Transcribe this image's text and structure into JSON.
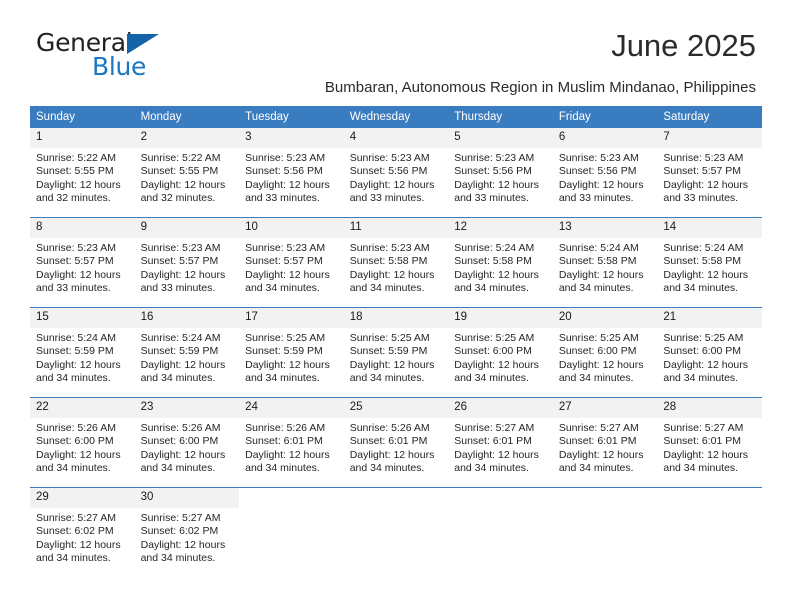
{
  "brand": {
    "name_top": "General",
    "name_bottom": "Blue",
    "color_dark": "#231f20",
    "color_blue": "#1b77c4"
  },
  "header": {
    "month_title": "June 2025",
    "location": "Bumbaran, Autonomous Region in Muslim Mindanao, Philippines"
  },
  "theme": {
    "header_bg": "#3a7cc0",
    "daynum_bg": "#f2f2f2",
    "grid_line": "#3a7cc0"
  },
  "calendar": {
    "weekday_headers": [
      "Sunday",
      "Monday",
      "Tuesday",
      "Wednesday",
      "Thursday",
      "Friday",
      "Saturday"
    ],
    "weeks": [
      [
        {
          "day": "1",
          "sunrise": "Sunrise: 5:22 AM",
          "sunset": "Sunset: 5:55 PM",
          "daylight_1": "Daylight: 12 hours",
          "daylight_2": "and 32 minutes."
        },
        {
          "day": "2",
          "sunrise": "Sunrise: 5:22 AM",
          "sunset": "Sunset: 5:55 PM",
          "daylight_1": "Daylight: 12 hours",
          "daylight_2": "and 32 minutes."
        },
        {
          "day": "3",
          "sunrise": "Sunrise: 5:23 AM",
          "sunset": "Sunset: 5:56 PM",
          "daylight_1": "Daylight: 12 hours",
          "daylight_2": "and 33 minutes."
        },
        {
          "day": "4",
          "sunrise": "Sunrise: 5:23 AM",
          "sunset": "Sunset: 5:56 PM",
          "daylight_1": "Daylight: 12 hours",
          "daylight_2": "and 33 minutes."
        },
        {
          "day": "5",
          "sunrise": "Sunrise: 5:23 AM",
          "sunset": "Sunset: 5:56 PM",
          "daylight_1": "Daylight: 12 hours",
          "daylight_2": "and 33 minutes."
        },
        {
          "day": "6",
          "sunrise": "Sunrise: 5:23 AM",
          "sunset": "Sunset: 5:56 PM",
          "daylight_1": "Daylight: 12 hours",
          "daylight_2": "and 33 minutes."
        },
        {
          "day": "7",
          "sunrise": "Sunrise: 5:23 AM",
          "sunset": "Sunset: 5:57 PM",
          "daylight_1": "Daylight: 12 hours",
          "daylight_2": "and 33 minutes."
        }
      ],
      [
        {
          "day": "8",
          "sunrise": "Sunrise: 5:23 AM",
          "sunset": "Sunset: 5:57 PM",
          "daylight_1": "Daylight: 12 hours",
          "daylight_2": "and 33 minutes."
        },
        {
          "day": "9",
          "sunrise": "Sunrise: 5:23 AM",
          "sunset": "Sunset: 5:57 PM",
          "daylight_1": "Daylight: 12 hours",
          "daylight_2": "and 33 minutes."
        },
        {
          "day": "10",
          "sunrise": "Sunrise: 5:23 AM",
          "sunset": "Sunset: 5:57 PM",
          "daylight_1": "Daylight: 12 hours",
          "daylight_2": "and 34 minutes."
        },
        {
          "day": "11",
          "sunrise": "Sunrise: 5:23 AM",
          "sunset": "Sunset: 5:58 PM",
          "daylight_1": "Daylight: 12 hours",
          "daylight_2": "and 34 minutes."
        },
        {
          "day": "12",
          "sunrise": "Sunrise: 5:24 AM",
          "sunset": "Sunset: 5:58 PM",
          "daylight_1": "Daylight: 12 hours",
          "daylight_2": "and 34 minutes."
        },
        {
          "day": "13",
          "sunrise": "Sunrise: 5:24 AM",
          "sunset": "Sunset: 5:58 PM",
          "daylight_1": "Daylight: 12 hours",
          "daylight_2": "and 34 minutes."
        },
        {
          "day": "14",
          "sunrise": "Sunrise: 5:24 AM",
          "sunset": "Sunset: 5:58 PM",
          "daylight_1": "Daylight: 12 hours",
          "daylight_2": "and 34 minutes."
        }
      ],
      [
        {
          "day": "15",
          "sunrise": "Sunrise: 5:24 AM",
          "sunset": "Sunset: 5:59 PM",
          "daylight_1": "Daylight: 12 hours",
          "daylight_2": "and 34 minutes."
        },
        {
          "day": "16",
          "sunrise": "Sunrise: 5:24 AM",
          "sunset": "Sunset: 5:59 PM",
          "daylight_1": "Daylight: 12 hours",
          "daylight_2": "and 34 minutes."
        },
        {
          "day": "17",
          "sunrise": "Sunrise: 5:25 AM",
          "sunset": "Sunset: 5:59 PM",
          "daylight_1": "Daylight: 12 hours",
          "daylight_2": "and 34 minutes."
        },
        {
          "day": "18",
          "sunrise": "Sunrise: 5:25 AM",
          "sunset": "Sunset: 5:59 PM",
          "daylight_1": "Daylight: 12 hours",
          "daylight_2": "and 34 minutes."
        },
        {
          "day": "19",
          "sunrise": "Sunrise: 5:25 AM",
          "sunset": "Sunset: 6:00 PM",
          "daylight_1": "Daylight: 12 hours",
          "daylight_2": "and 34 minutes."
        },
        {
          "day": "20",
          "sunrise": "Sunrise: 5:25 AM",
          "sunset": "Sunset: 6:00 PM",
          "daylight_1": "Daylight: 12 hours",
          "daylight_2": "and 34 minutes."
        },
        {
          "day": "21",
          "sunrise": "Sunrise: 5:25 AM",
          "sunset": "Sunset: 6:00 PM",
          "daylight_1": "Daylight: 12 hours",
          "daylight_2": "and 34 minutes."
        }
      ],
      [
        {
          "day": "22",
          "sunrise": "Sunrise: 5:26 AM",
          "sunset": "Sunset: 6:00 PM",
          "daylight_1": "Daylight: 12 hours",
          "daylight_2": "and 34 minutes."
        },
        {
          "day": "23",
          "sunrise": "Sunrise: 5:26 AM",
          "sunset": "Sunset: 6:00 PM",
          "daylight_1": "Daylight: 12 hours",
          "daylight_2": "and 34 minutes."
        },
        {
          "day": "24",
          "sunrise": "Sunrise: 5:26 AM",
          "sunset": "Sunset: 6:01 PM",
          "daylight_1": "Daylight: 12 hours",
          "daylight_2": "and 34 minutes."
        },
        {
          "day": "25",
          "sunrise": "Sunrise: 5:26 AM",
          "sunset": "Sunset: 6:01 PM",
          "daylight_1": "Daylight: 12 hours",
          "daylight_2": "and 34 minutes."
        },
        {
          "day": "26",
          "sunrise": "Sunrise: 5:27 AM",
          "sunset": "Sunset: 6:01 PM",
          "daylight_1": "Daylight: 12 hours",
          "daylight_2": "and 34 minutes."
        },
        {
          "day": "27",
          "sunrise": "Sunrise: 5:27 AM",
          "sunset": "Sunset: 6:01 PM",
          "daylight_1": "Daylight: 12 hours",
          "daylight_2": "and 34 minutes."
        },
        {
          "day": "28",
          "sunrise": "Sunrise: 5:27 AM",
          "sunset": "Sunset: 6:01 PM",
          "daylight_1": "Daylight: 12 hours",
          "daylight_2": "and 34 minutes."
        }
      ],
      [
        {
          "day": "29",
          "sunrise": "Sunrise: 5:27 AM",
          "sunset": "Sunset: 6:02 PM",
          "daylight_1": "Daylight: 12 hours",
          "daylight_2": "and 34 minutes."
        },
        {
          "day": "30",
          "sunrise": "Sunrise: 5:27 AM",
          "sunset": "Sunset: 6:02 PM",
          "daylight_1": "Daylight: 12 hours",
          "daylight_2": "and 34 minutes."
        },
        {
          "day": "",
          "sunrise": "",
          "sunset": "",
          "daylight_1": "",
          "daylight_2": ""
        },
        {
          "day": "",
          "sunrise": "",
          "sunset": "",
          "daylight_1": "",
          "daylight_2": ""
        },
        {
          "day": "",
          "sunrise": "",
          "sunset": "",
          "daylight_1": "",
          "daylight_2": ""
        },
        {
          "day": "",
          "sunrise": "",
          "sunset": "",
          "daylight_1": "",
          "daylight_2": ""
        },
        {
          "day": "",
          "sunrise": "",
          "sunset": "",
          "daylight_1": "",
          "daylight_2": ""
        }
      ]
    ]
  }
}
